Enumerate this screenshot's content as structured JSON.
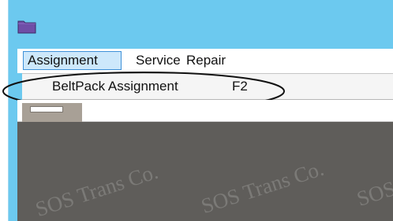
{
  "menubar": {
    "items": [
      {
        "label": "Assignment",
        "active": true
      },
      {
        "label": "Service",
        "active": false
      },
      {
        "label": "Repair",
        "active": false
      }
    ]
  },
  "dropdown": {
    "items": [
      {
        "label": "BeltPack Assignment",
        "shortcut": "F2"
      }
    ]
  },
  "content": {
    "watermarks": [
      "SOS Trans Co.",
      "SOS Trans Co.",
      "SOS"
    ]
  },
  "colors": {
    "window_frame": "#6cc9ef",
    "content_background": "#5f5d5a",
    "active_menu_background": "#cde8fb",
    "active_menu_border": "#3f91d8"
  },
  "icons": {
    "title_icon": "folder-icon"
  }
}
